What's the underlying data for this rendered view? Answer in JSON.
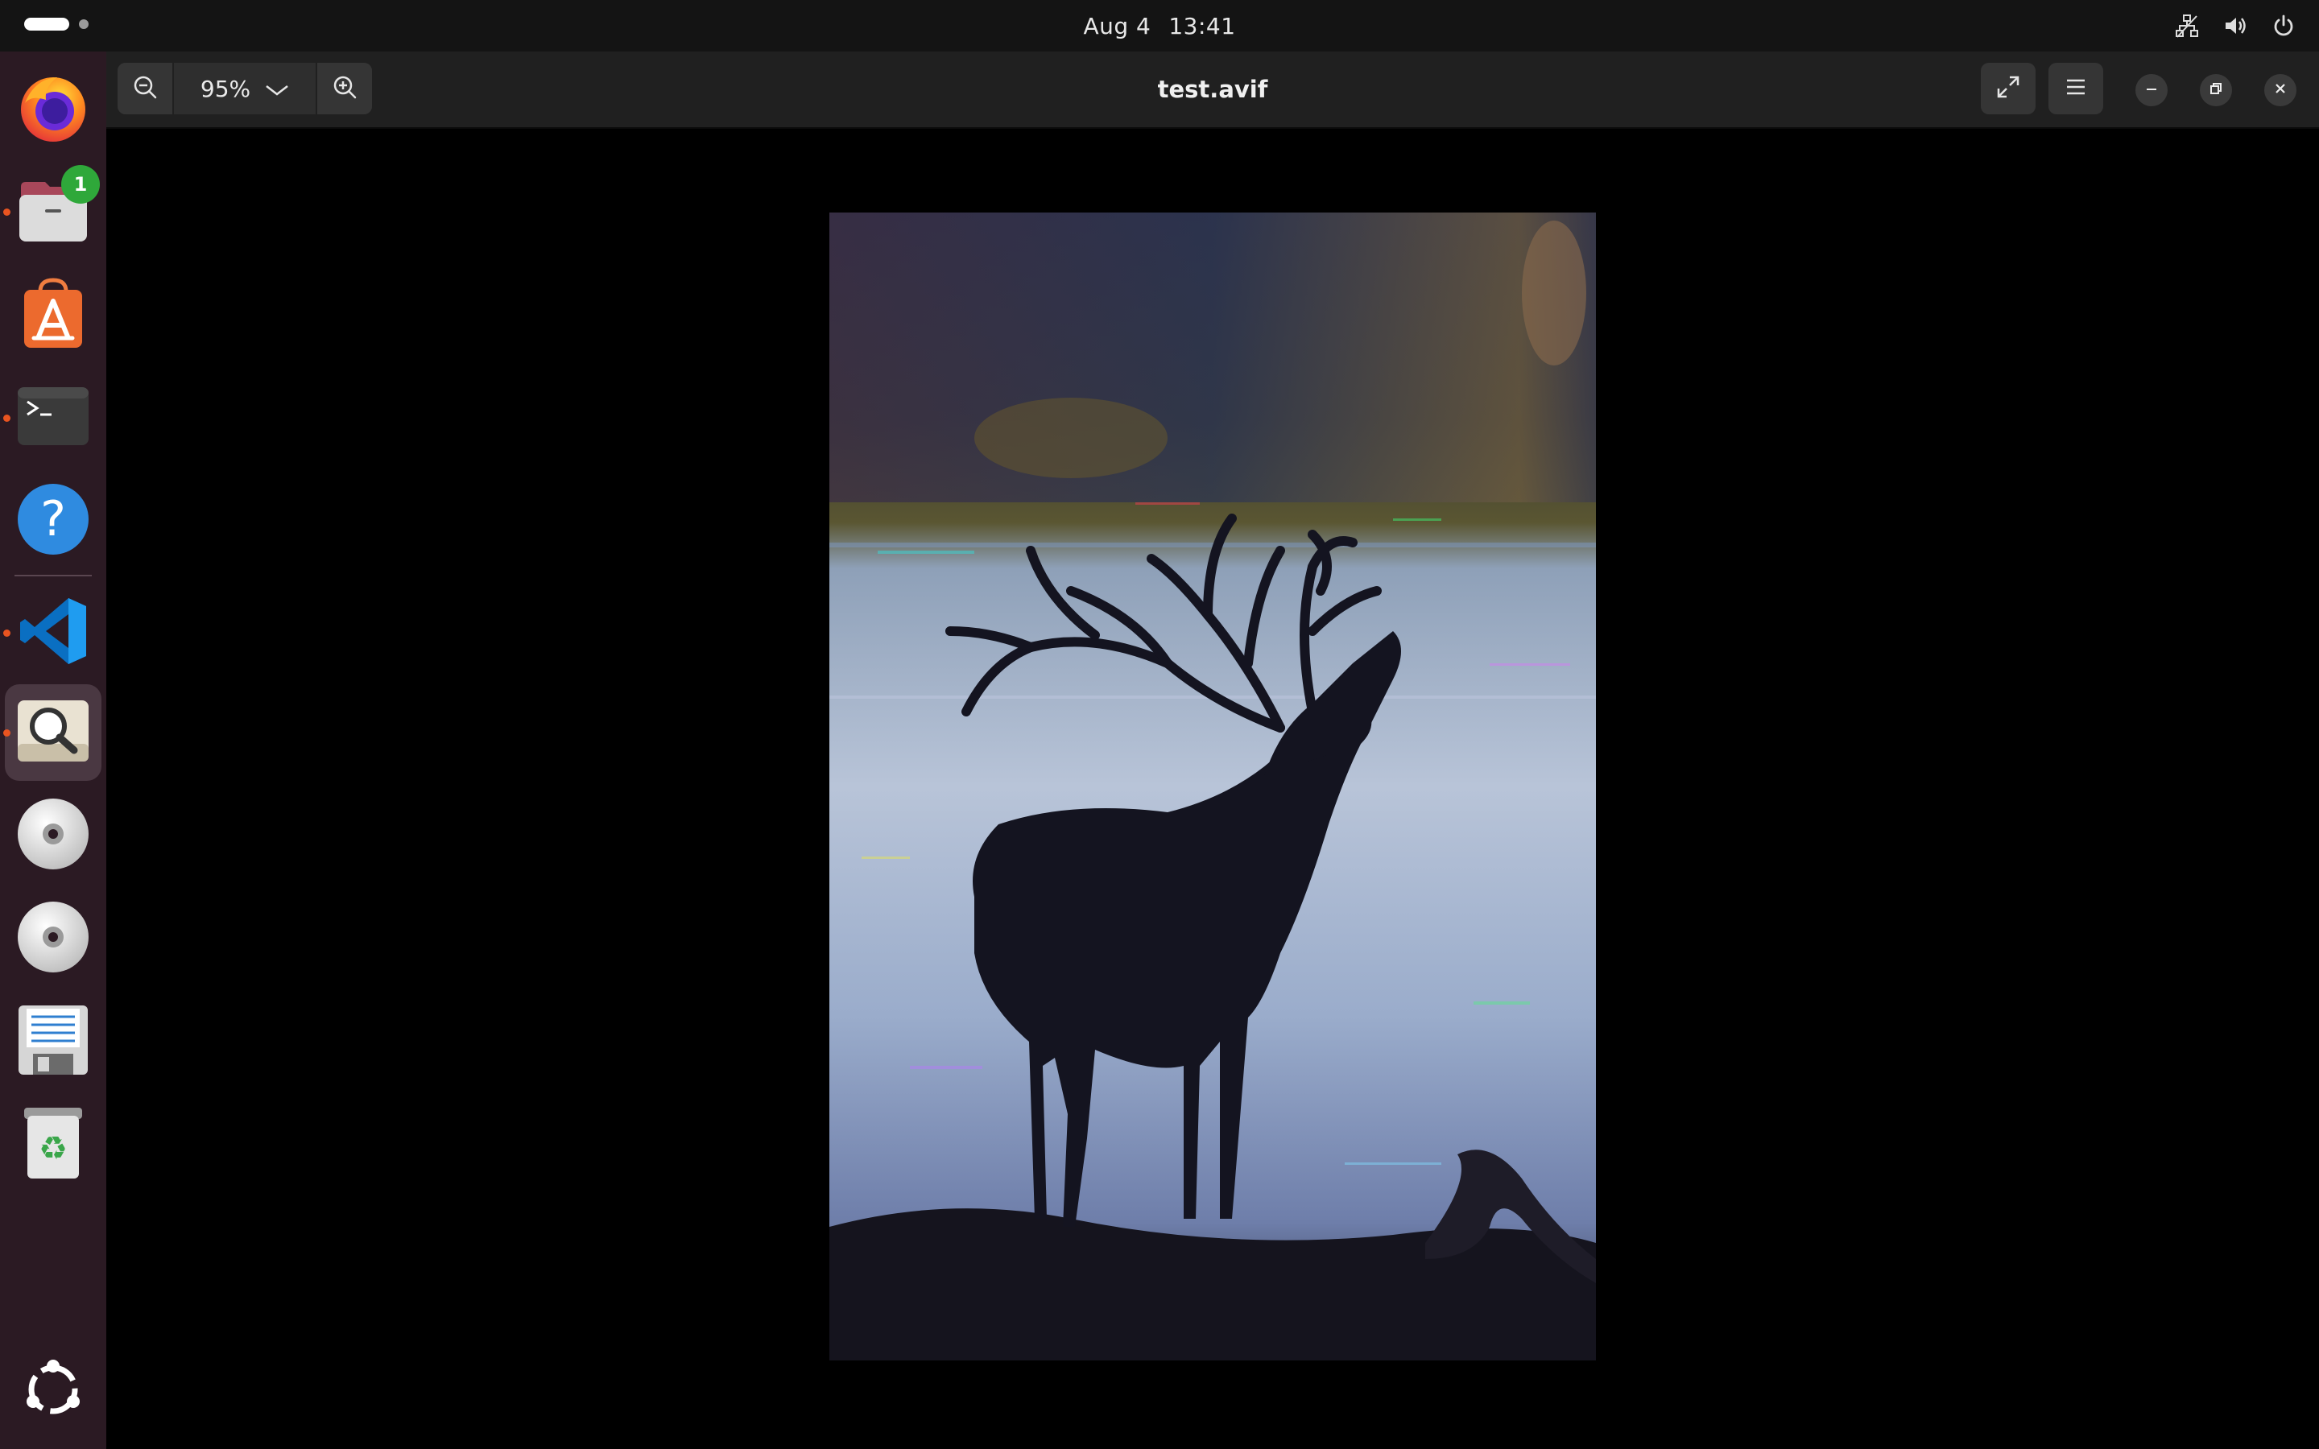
{
  "topbar": {
    "date": "Aug 4",
    "time": "13:41",
    "tray_icons": [
      "network-icon",
      "volume-icon",
      "power-icon"
    ]
  },
  "dock": {
    "items": [
      {
        "name": "firefox",
        "icon": "firefox-icon",
        "running": false
      },
      {
        "name": "files",
        "icon": "files-icon",
        "running": true,
        "badge": "1"
      },
      {
        "name": "app-center",
        "icon": "app-center-icon",
        "running": false
      },
      {
        "name": "terminal",
        "icon": "terminal-icon",
        "running": true
      },
      {
        "name": "help",
        "icon": "help-icon",
        "running": false
      },
      {
        "name": "vscode",
        "icon": "vscode-icon",
        "running": true
      },
      {
        "name": "image-viewer",
        "icon": "image-viewer-icon",
        "running": true,
        "active": true
      },
      {
        "name": "disc-1",
        "icon": "disc-icon",
        "running": false
      },
      {
        "name": "disc-2",
        "icon": "disc-icon",
        "running": false
      },
      {
        "name": "save",
        "icon": "floppy-icon",
        "running": false
      },
      {
        "name": "trash",
        "icon": "trash-icon",
        "running": false
      },
      {
        "name": "show-apps",
        "icon": "ubuntu-logo-icon",
        "running": false
      }
    ]
  },
  "viewer": {
    "title": "test.avif",
    "zoom_value": "95%",
    "image_description_icon": "deer-silhouette-image"
  },
  "colors": {
    "accent": "#e95420",
    "dock_bg": "#2b1a23",
    "header_bg": "#202020",
    "badge": "#2fa83a"
  }
}
